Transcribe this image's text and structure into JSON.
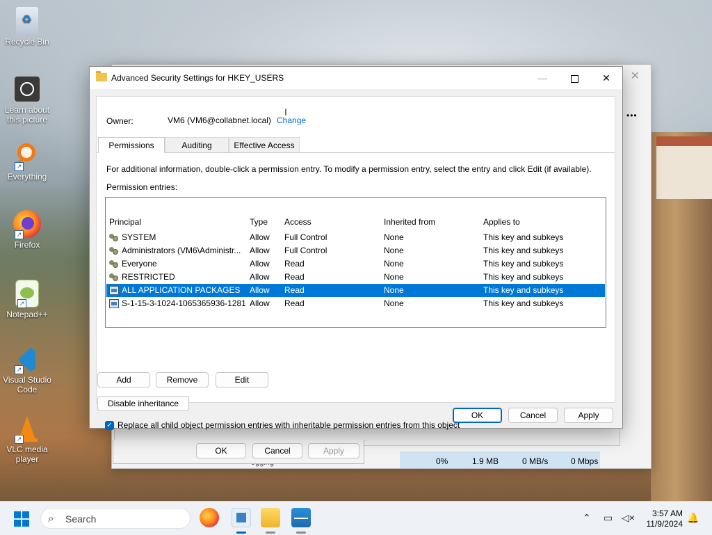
{
  "desktop": {
    "icons": [
      {
        "label": "Recycle Bin"
      },
      {
        "label": "Learn about this picture"
      },
      {
        "label": "Everything"
      },
      {
        "label": "Firefox"
      },
      {
        "label": "Notepad++"
      },
      {
        "label": "Visual Studio Code"
      },
      {
        "label": "VLC media player"
      }
    ]
  },
  "back_window": {
    "close_glyph": "✕",
    "more_glyph": "•••",
    "buttons": {
      "ok": "OK",
      "cancel": "Cancel",
      "apply": "Apply"
    },
    "perf": {
      "cpu": "0%",
      "memory": "1.9 MB",
      "disk": "0 MB/s",
      "network": "0 Mbps"
    },
    "row_snippet": "ogging"
  },
  "dialog": {
    "title": "Advanced Security Settings for HKEY_USERS",
    "controls": {
      "minimize": "—",
      "close": "✕"
    },
    "owner_label": "Owner:",
    "owner_value": "VM6 (VM6@collabnet.local)",
    "owner_change": "Change",
    "tabs": [
      "Permissions",
      "Auditing",
      "Effective Access"
    ],
    "info_text": "For additional information, double-click a permission entry. To modify a permission entry, select the entry and click Edit (if available).",
    "permission_entries_label": "Permission entries:",
    "columns": [
      "Principal",
      "Type",
      "Access",
      "Inherited from",
      "Applies to"
    ],
    "rows": [
      {
        "principal": "SYSTEM",
        "type": "Allow",
        "access": "Full Control",
        "inherited": "None",
        "applies": "This key and subkeys",
        "icon": "users"
      },
      {
        "principal": "Administrators (VM6\\Administr...",
        "type": "Allow",
        "access": "Full Control",
        "inherited": "None",
        "applies": "This key and subkeys",
        "icon": "users"
      },
      {
        "principal": "Everyone",
        "type": "Allow",
        "access": "Read",
        "inherited": "None",
        "applies": "This key and subkeys",
        "icon": "users"
      },
      {
        "principal": "RESTRICTED",
        "type": "Allow",
        "access": "Read",
        "inherited": "None",
        "applies": "This key and subkeys",
        "icon": "users"
      },
      {
        "principal": "ALL APPLICATION PACKAGES",
        "type": "Allow",
        "access": "Read",
        "inherited": "None",
        "applies": "This key and subkeys",
        "icon": "pkg",
        "selected": true
      },
      {
        "principal": "S-1-15-3-1024-1065365936-1281...",
        "type": "Allow",
        "access": "Read",
        "inherited": "None",
        "applies": "This key and subkeys",
        "icon": "pkg"
      }
    ],
    "buttons": {
      "add": "Add",
      "remove": "Remove",
      "edit": "Edit",
      "disable_inheritance": "Disable inheritance",
      "ok": "OK",
      "cancel": "Cancel",
      "apply": "Apply"
    },
    "checkbox_label": "Replace all child object permission entries with inheritable permission entries from this object",
    "checkbox_checked": true
  },
  "taskbar": {
    "search_placeholder": "Search",
    "time": "3:57 AM",
    "date": "11/9/2024"
  },
  "colors": {
    "accent": "#0078d7",
    "link": "#0066cc",
    "folder": "#f0c34d"
  }
}
